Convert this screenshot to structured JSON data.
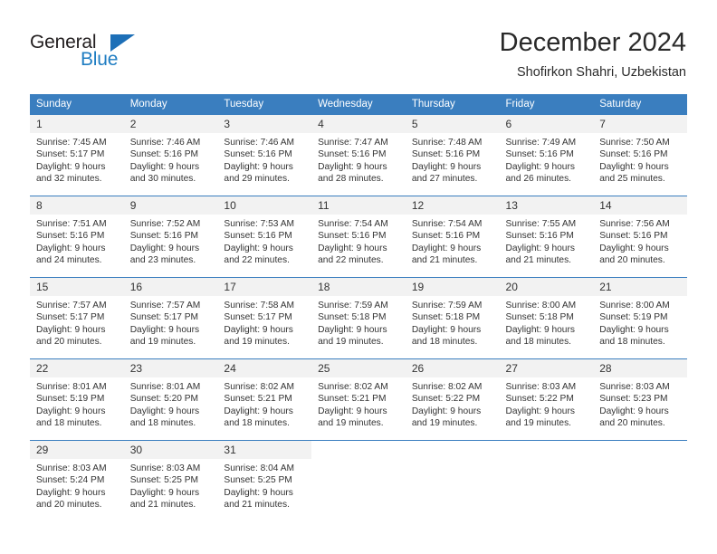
{
  "brand": {
    "name_part1": "General",
    "name_part2": "Blue",
    "color_dark": "#231f20",
    "color_blue": "#1f7dc2"
  },
  "header": {
    "title": "December 2024",
    "subtitle": "Shofirkon Shahri, Uzbekistan"
  },
  "theme": {
    "header_row_bg": "#3a7ebf",
    "daynum_bg": "#f2f2f2",
    "text": "#333333"
  },
  "weekday_headers": [
    "Sunday",
    "Monday",
    "Tuesday",
    "Wednesday",
    "Thursday",
    "Friday",
    "Saturday"
  ],
  "weeks": [
    [
      {
        "day": "1",
        "sunrise": "Sunrise: 7:45 AM",
        "sunset": "Sunset: 5:17 PM",
        "daylight1": "Daylight: 9 hours",
        "daylight2": "and 32 minutes."
      },
      {
        "day": "2",
        "sunrise": "Sunrise: 7:46 AM",
        "sunset": "Sunset: 5:16 PM",
        "daylight1": "Daylight: 9 hours",
        "daylight2": "and 30 minutes."
      },
      {
        "day": "3",
        "sunrise": "Sunrise: 7:46 AM",
        "sunset": "Sunset: 5:16 PM",
        "daylight1": "Daylight: 9 hours",
        "daylight2": "and 29 minutes."
      },
      {
        "day": "4",
        "sunrise": "Sunrise: 7:47 AM",
        "sunset": "Sunset: 5:16 PM",
        "daylight1": "Daylight: 9 hours",
        "daylight2": "and 28 minutes."
      },
      {
        "day": "5",
        "sunrise": "Sunrise: 7:48 AM",
        "sunset": "Sunset: 5:16 PM",
        "daylight1": "Daylight: 9 hours",
        "daylight2": "and 27 minutes."
      },
      {
        "day": "6",
        "sunrise": "Sunrise: 7:49 AM",
        "sunset": "Sunset: 5:16 PM",
        "daylight1": "Daylight: 9 hours",
        "daylight2": "and 26 minutes."
      },
      {
        "day": "7",
        "sunrise": "Sunrise: 7:50 AM",
        "sunset": "Sunset: 5:16 PM",
        "daylight1": "Daylight: 9 hours",
        "daylight2": "and 25 minutes."
      }
    ],
    [
      {
        "day": "8",
        "sunrise": "Sunrise: 7:51 AM",
        "sunset": "Sunset: 5:16 PM",
        "daylight1": "Daylight: 9 hours",
        "daylight2": "and 24 minutes."
      },
      {
        "day": "9",
        "sunrise": "Sunrise: 7:52 AM",
        "sunset": "Sunset: 5:16 PM",
        "daylight1": "Daylight: 9 hours",
        "daylight2": "and 23 minutes."
      },
      {
        "day": "10",
        "sunrise": "Sunrise: 7:53 AM",
        "sunset": "Sunset: 5:16 PM",
        "daylight1": "Daylight: 9 hours",
        "daylight2": "and 22 minutes."
      },
      {
        "day": "11",
        "sunrise": "Sunrise: 7:54 AM",
        "sunset": "Sunset: 5:16 PM",
        "daylight1": "Daylight: 9 hours",
        "daylight2": "and 22 minutes."
      },
      {
        "day": "12",
        "sunrise": "Sunrise: 7:54 AM",
        "sunset": "Sunset: 5:16 PM",
        "daylight1": "Daylight: 9 hours",
        "daylight2": "and 21 minutes."
      },
      {
        "day": "13",
        "sunrise": "Sunrise: 7:55 AM",
        "sunset": "Sunset: 5:16 PM",
        "daylight1": "Daylight: 9 hours",
        "daylight2": "and 21 minutes."
      },
      {
        "day": "14",
        "sunrise": "Sunrise: 7:56 AM",
        "sunset": "Sunset: 5:16 PM",
        "daylight1": "Daylight: 9 hours",
        "daylight2": "and 20 minutes."
      }
    ],
    [
      {
        "day": "15",
        "sunrise": "Sunrise: 7:57 AM",
        "sunset": "Sunset: 5:17 PM",
        "daylight1": "Daylight: 9 hours",
        "daylight2": "and 20 minutes."
      },
      {
        "day": "16",
        "sunrise": "Sunrise: 7:57 AM",
        "sunset": "Sunset: 5:17 PM",
        "daylight1": "Daylight: 9 hours",
        "daylight2": "and 19 minutes."
      },
      {
        "day": "17",
        "sunrise": "Sunrise: 7:58 AM",
        "sunset": "Sunset: 5:17 PM",
        "daylight1": "Daylight: 9 hours",
        "daylight2": "and 19 minutes."
      },
      {
        "day": "18",
        "sunrise": "Sunrise: 7:59 AM",
        "sunset": "Sunset: 5:18 PM",
        "daylight1": "Daylight: 9 hours",
        "daylight2": "and 19 minutes."
      },
      {
        "day": "19",
        "sunrise": "Sunrise: 7:59 AM",
        "sunset": "Sunset: 5:18 PM",
        "daylight1": "Daylight: 9 hours",
        "daylight2": "and 18 minutes."
      },
      {
        "day": "20",
        "sunrise": "Sunrise: 8:00 AM",
        "sunset": "Sunset: 5:18 PM",
        "daylight1": "Daylight: 9 hours",
        "daylight2": "and 18 minutes."
      },
      {
        "day": "21",
        "sunrise": "Sunrise: 8:00 AM",
        "sunset": "Sunset: 5:19 PM",
        "daylight1": "Daylight: 9 hours",
        "daylight2": "and 18 minutes."
      }
    ],
    [
      {
        "day": "22",
        "sunrise": "Sunrise: 8:01 AM",
        "sunset": "Sunset: 5:19 PM",
        "daylight1": "Daylight: 9 hours",
        "daylight2": "and 18 minutes."
      },
      {
        "day": "23",
        "sunrise": "Sunrise: 8:01 AM",
        "sunset": "Sunset: 5:20 PM",
        "daylight1": "Daylight: 9 hours",
        "daylight2": "and 18 minutes."
      },
      {
        "day": "24",
        "sunrise": "Sunrise: 8:02 AM",
        "sunset": "Sunset: 5:21 PM",
        "daylight1": "Daylight: 9 hours",
        "daylight2": "and 18 minutes."
      },
      {
        "day": "25",
        "sunrise": "Sunrise: 8:02 AM",
        "sunset": "Sunset: 5:21 PM",
        "daylight1": "Daylight: 9 hours",
        "daylight2": "and 19 minutes."
      },
      {
        "day": "26",
        "sunrise": "Sunrise: 8:02 AM",
        "sunset": "Sunset: 5:22 PM",
        "daylight1": "Daylight: 9 hours",
        "daylight2": "and 19 minutes."
      },
      {
        "day": "27",
        "sunrise": "Sunrise: 8:03 AM",
        "sunset": "Sunset: 5:22 PM",
        "daylight1": "Daylight: 9 hours",
        "daylight2": "and 19 minutes."
      },
      {
        "day": "28",
        "sunrise": "Sunrise: 8:03 AM",
        "sunset": "Sunset: 5:23 PM",
        "daylight1": "Daylight: 9 hours",
        "daylight2": "and 20 minutes."
      }
    ],
    [
      {
        "day": "29",
        "sunrise": "Sunrise: 8:03 AM",
        "sunset": "Sunset: 5:24 PM",
        "daylight1": "Daylight: 9 hours",
        "daylight2": "and 20 minutes."
      },
      {
        "day": "30",
        "sunrise": "Sunrise: 8:03 AM",
        "sunset": "Sunset: 5:25 PM",
        "daylight1": "Daylight: 9 hours",
        "daylight2": "and 21 minutes."
      },
      {
        "day": "31",
        "sunrise": "Sunrise: 8:04 AM",
        "sunset": "Sunset: 5:25 PM",
        "daylight1": "Daylight: 9 hours",
        "daylight2": "and 21 minutes."
      },
      {
        "day": "",
        "sunrise": "",
        "sunset": "",
        "daylight1": "",
        "daylight2": ""
      },
      {
        "day": "",
        "sunrise": "",
        "sunset": "",
        "daylight1": "",
        "daylight2": ""
      },
      {
        "day": "",
        "sunrise": "",
        "sunset": "",
        "daylight1": "",
        "daylight2": ""
      },
      {
        "day": "",
        "sunrise": "",
        "sunset": "",
        "daylight1": "",
        "daylight2": ""
      }
    ]
  ]
}
